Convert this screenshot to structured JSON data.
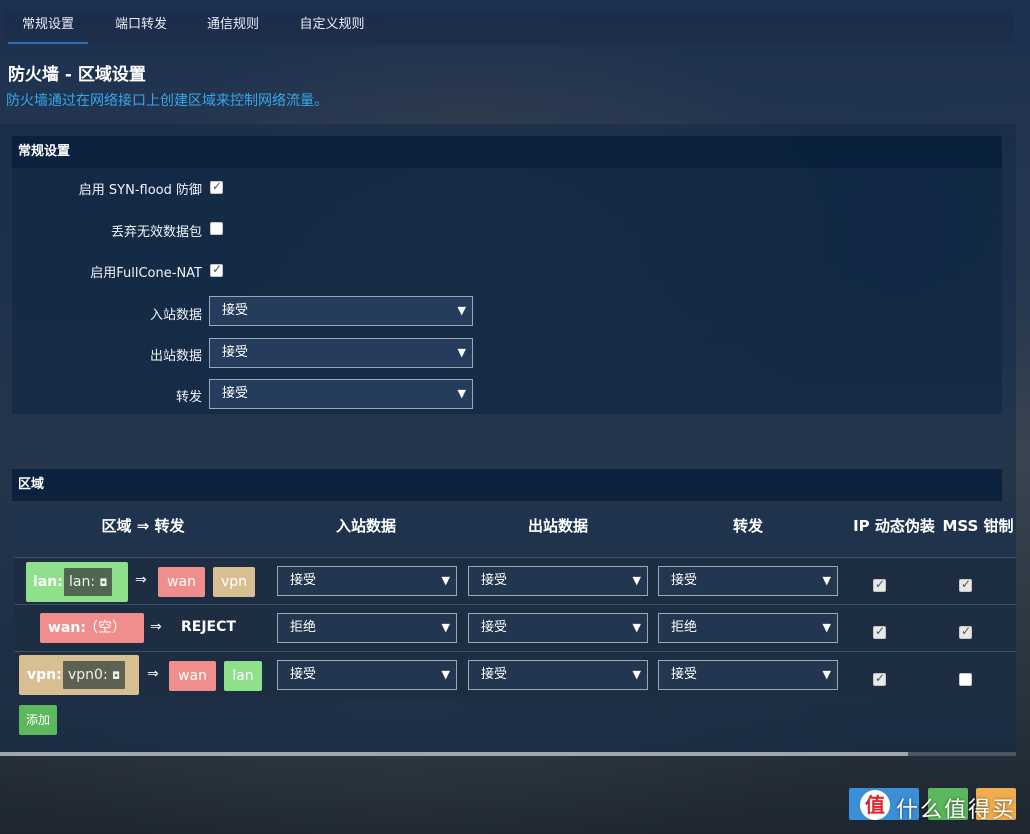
{
  "tabs": [
    {
      "label": "常规设置",
      "active": true
    },
    {
      "label": "端口转发",
      "active": false
    },
    {
      "label": "通信规则",
      "active": false
    },
    {
      "label": "自定义规则",
      "active": false
    }
  ],
  "page": {
    "title": "防火墙 - 区域设置",
    "description": "防火墙通过在网络接口上创建区域来控制网络流量。"
  },
  "general": {
    "heading": "常规设置",
    "syn_flood_label": "启用 SYN-flood 防御",
    "syn_flood_checked": true,
    "drop_invalid_label": "丢弃无效数据包",
    "drop_invalid_checked": false,
    "fullcone_label": "启用FullCone-NAT",
    "fullcone_checked": true,
    "input_label": "入站数据",
    "input_value": "接受",
    "output_label": "出站数据",
    "output_value": "接受",
    "forward_label": "转发",
    "forward_value": "接受"
  },
  "zones": {
    "heading": "区域",
    "columns": [
      "区域 ⇒ 转发",
      "入站数据",
      "出站数据",
      "转发",
      "IP 动态伪装",
      "MSS 钳制"
    ],
    "rows": [
      {
        "zone": "lan:",
        "zone_color": "#8fe08a",
        "iface": "lan:",
        "arrow": "⇒",
        "targets": [
          "wan",
          "vpn"
        ],
        "input": "接受",
        "output": "接受",
        "forward": "接受",
        "masq": true,
        "mss": true
      },
      {
        "zone": "wan:",
        "zone_color": "#f08e8e",
        "iface": "（空）",
        "arrow": "⇒",
        "reject": "REJECT",
        "input": "拒绝",
        "output": "接受",
        "forward": "拒绝",
        "masq": true,
        "mss": true
      },
      {
        "zone": "vpn:",
        "zone_color": "#d8bf92",
        "iface": "vpn0:",
        "arrow": "⇒",
        "targets": [
          "wan",
          "lan"
        ],
        "input": "接受",
        "output": "接受",
        "forward": "接受",
        "masq": true,
        "mss": false
      }
    ],
    "add_label": "添加"
  },
  "watermark": {
    "logo": "值",
    "text": "什么值得买"
  }
}
